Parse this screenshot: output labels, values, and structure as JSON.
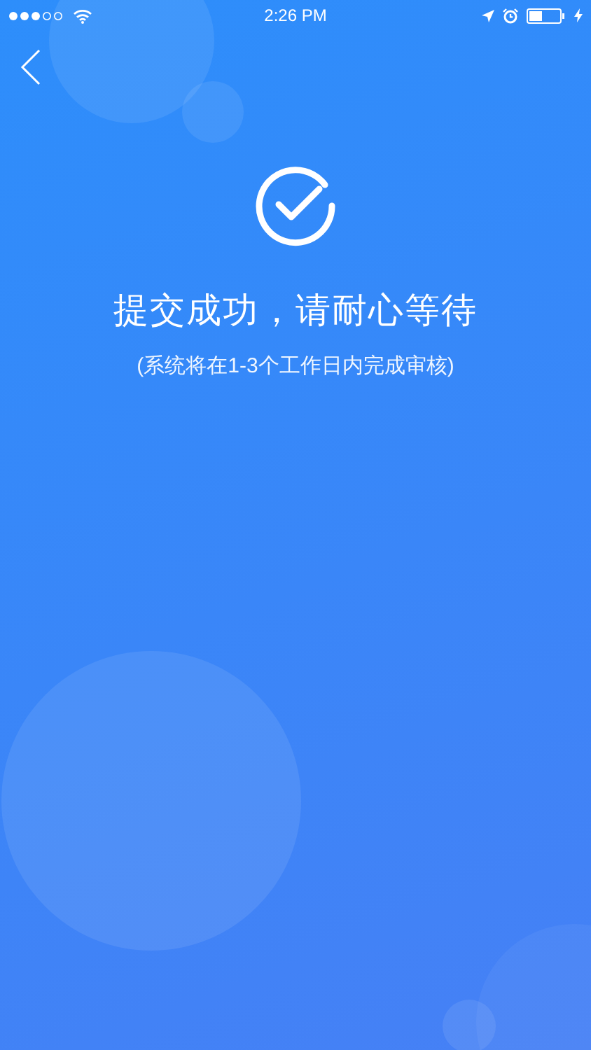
{
  "status_bar": {
    "time": "2:26 PM"
  },
  "result": {
    "title": "提交成功，请耐心等待",
    "note": "(系统将在1-3个工作日内完成审核)"
  }
}
